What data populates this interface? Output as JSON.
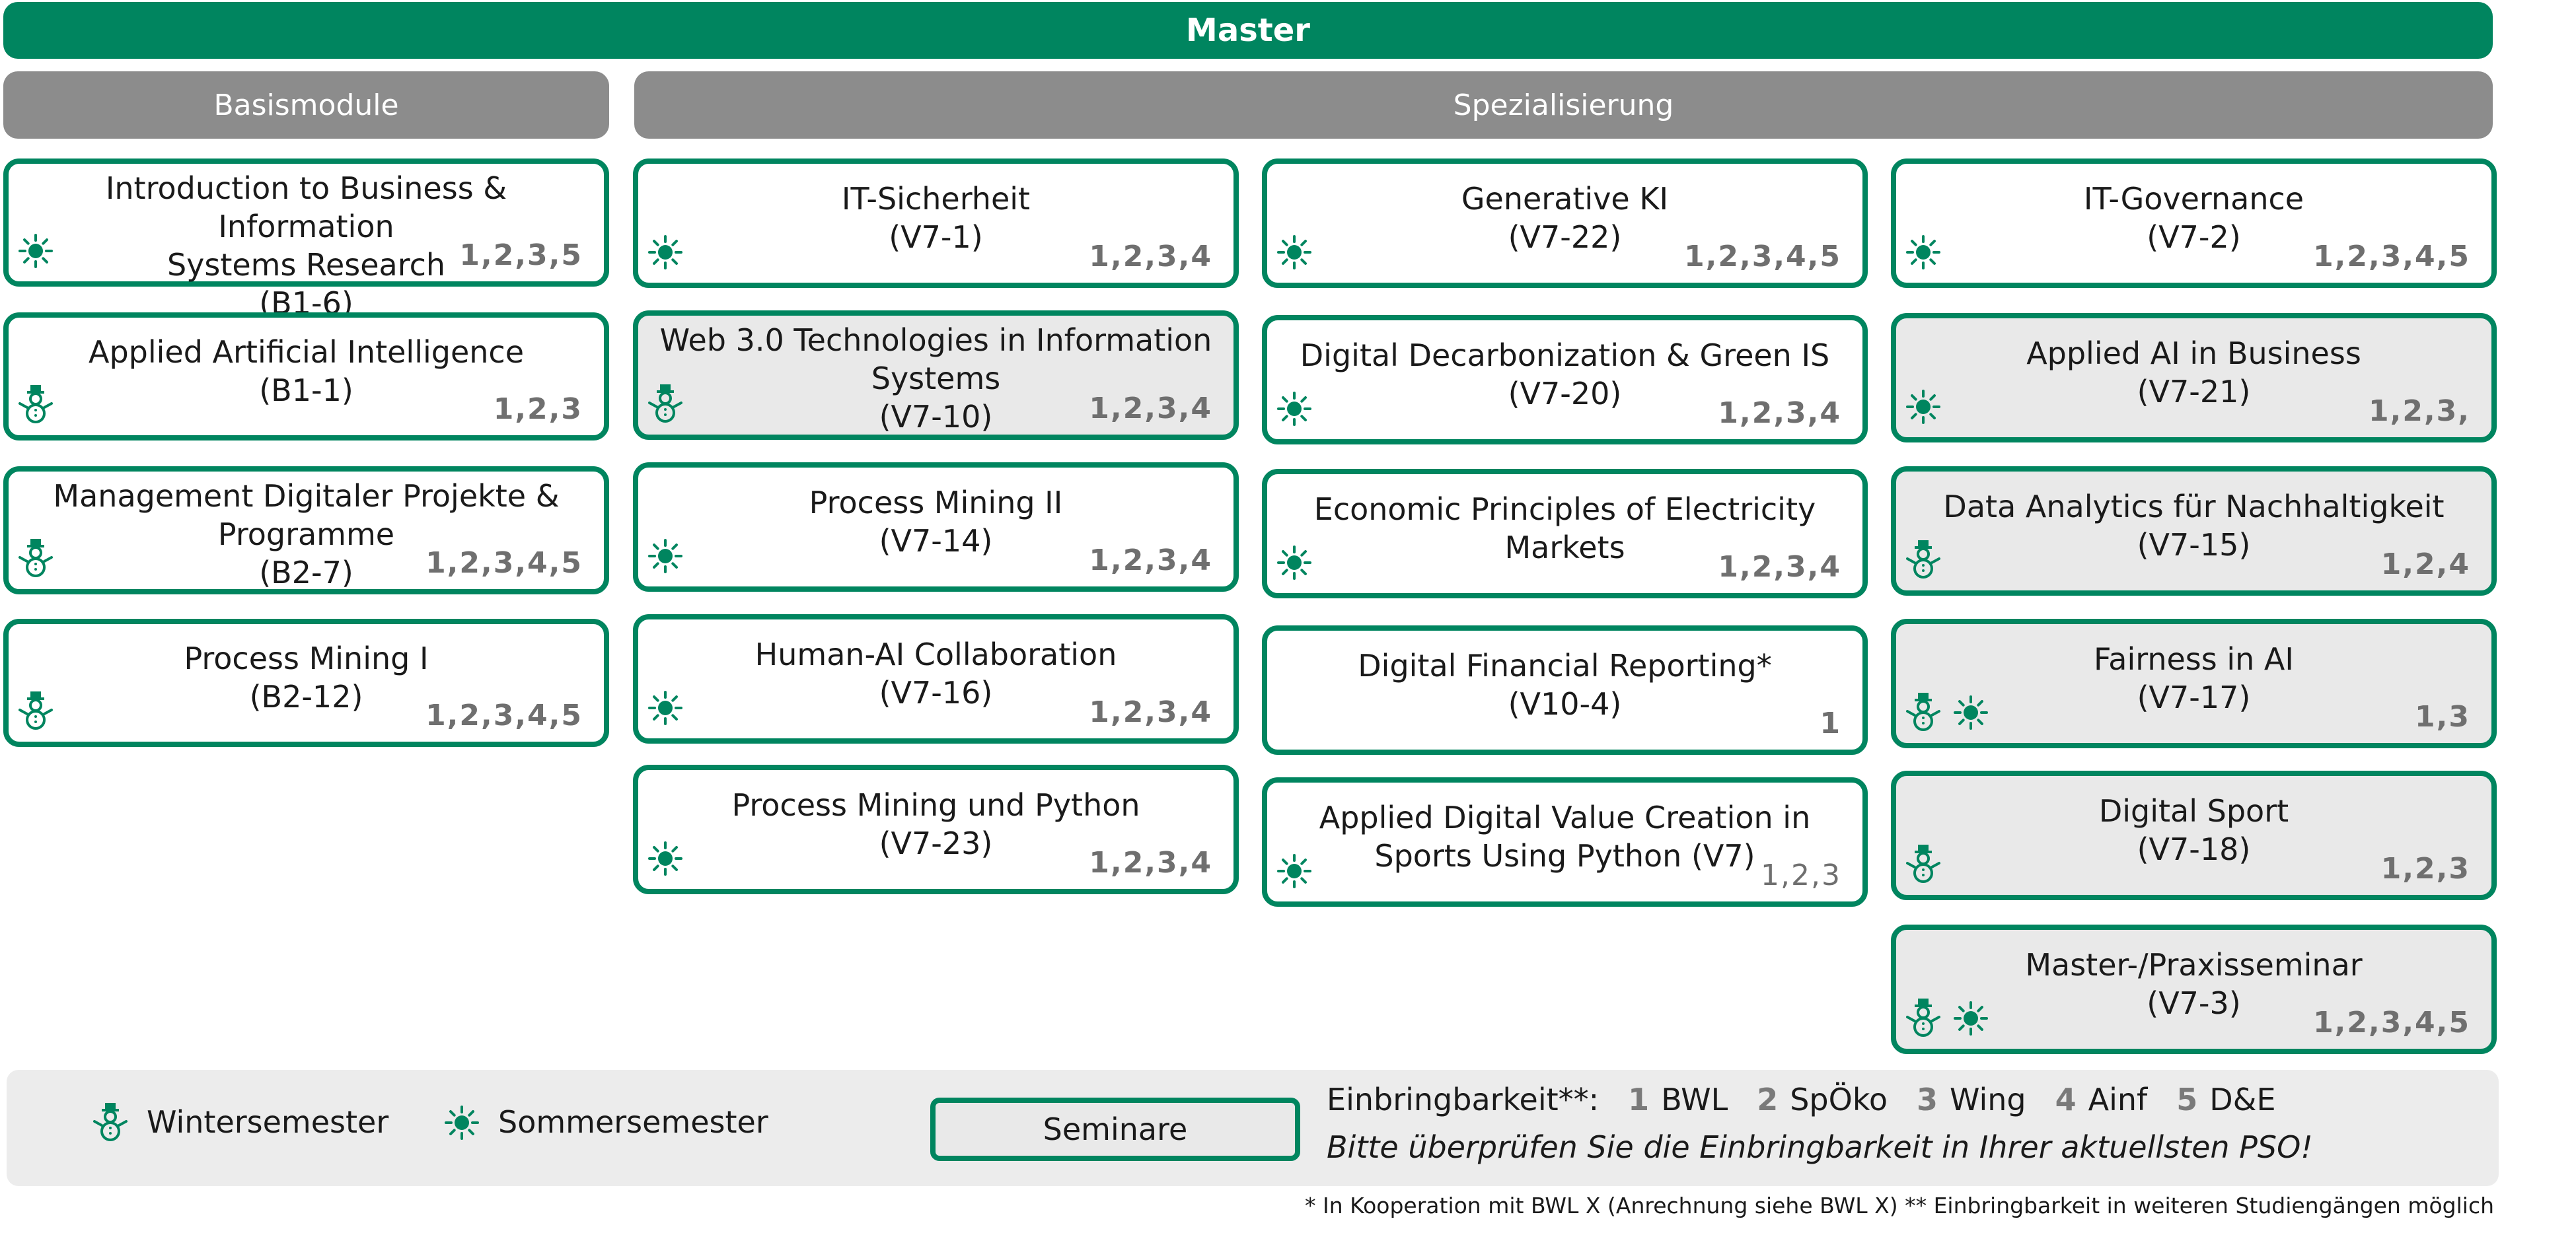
{
  "header": {
    "title": "Master"
  },
  "sections": {
    "basis": "Basismodule",
    "spez": "Spezialisierung"
  },
  "modules": [
    {
      "title": "Introduction to Business & Information\nSystems Research",
      "code": "(B1-6)",
      "codes": "1,2,3,5",
      "icons": [
        "sun-icon"
      ],
      "seminar": false
    },
    {
      "title": "Applied Artificial Intelligence",
      "code": "(B1-1)",
      "codes": "1,2,3",
      "icons": [
        "snowman-icon"
      ],
      "seminar": false
    },
    {
      "title": "Management Digitaler Projekte &\nProgramme",
      "code": "(B2-7)",
      "codes": "1,2,3,4,5",
      "icons": [
        "snowman-icon"
      ],
      "seminar": false
    },
    {
      "title": "Process Mining I",
      "code": "(B2-12)",
      "codes": "1,2,3,4,5",
      "icons": [
        "snowman-icon"
      ],
      "seminar": false
    },
    {
      "title": "IT-Sicherheit",
      "code": "(V7-1)",
      "codes": "1,2,3,4",
      "icons": [
        "sun-icon"
      ],
      "seminar": false
    },
    {
      "title": "Web 3.0 Technologies in Information\nSystems",
      "code": "(V7-10)",
      "codes": "1,2,3,4",
      "icons": [
        "snowman-icon"
      ],
      "seminar": true
    },
    {
      "title": "Process Mining II",
      "code": "(V7-14)",
      "codes": "1,2,3,4",
      "icons": [
        "sun-icon"
      ],
      "seminar": false
    },
    {
      "title": "Human-AI Collaboration",
      "code": "(V7-16)",
      "codes": "1,2,3,4",
      "icons": [
        "sun-icon"
      ],
      "seminar": false
    },
    {
      "title": "Process Mining und Python",
      "code": "(V7-23)",
      "codes": "1,2,3,4",
      "icons": [
        "sun-icon"
      ],
      "seminar": false
    },
    {
      "title": "Generative KI",
      "code": "(V7-22)",
      "codes": "1,2,3,4,5",
      "icons": [
        "sun-icon"
      ],
      "seminar": false
    },
    {
      "title": "Digital Decarbonization & Green IS",
      "code": "(V7-20)",
      "codes": "1,2,3,4",
      "icons": [
        "sun-icon"
      ],
      "seminar": false
    },
    {
      "title": "Economic Principles of Electricity\nMarkets",
      "code": "",
      "codes": "1,2,3,4",
      "icons": [
        "sun-icon"
      ],
      "seminar": false
    },
    {
      "title": "Digital Financial Reporting*",
      "code": "(V10-4)",
      "codes": "1",
      "icons": [],
      "seminar": false
    },
    {
      "title": "Applied Digital Value Creation in\nSports Using Python (V7)",
      "code": "",
      "codes": "1,2,3",
      "icons": [
        "sun-icon"
      ],
      "seminar": false,
      "light_codes": true
    },
    {
      "title": "IT-Governance",
      "code": "(V7-2)",
      "codes": "1,2,3,4,5",
      "icons": [
        "sun-icon"
      ],
      "seminar": false
    },
    {
      "title": "Applied AI in Business",
      "code": "(V7-21)",
      "codes": "1,2,3,",
      "icons": [
        "sun-icon"
      ],
      "seminar": true
    },
    {
      "title": "Data Analytics für Nachhaltigkeit",
      "code": "(V7-15)",
      "codes": "1,2,4",
      "icons": [
        "snowman-icon"
      ],
      "seminar": true
    },
    {
      "title": "Fairness in AI",
      "code": "(V7-17)",
      "codes": "1,3",
      "icons": [
        "snowman-icon",
        "sun-icon"
      ],
      "seminar": true
    },
    {
      "title": "Digital Sport",
      "code": "(V7-18)",
      "codes": "1,2,3",
      "icons": [
        "snowman-icon"
      ],
      "seminar": true
    },
    {
      "title": "Master-/Praxisseminar",
      "code": "(V7-3)",
      "codes": "1,2,3,4,5",
      "icons": [
        "snowman-icon",
        "sun-icon"
      ],
      "seminar": true
    }
  ],
  "legend": {
    "winter": "Wintersemester",
    "summer": "Sommersemester",
    "seminar": "Seminare",
    "einbring_label": "Einbringbarkeit**:",
    "einbring_items": [
      {
        "num": "1",
        "label": "BWL"
      },
      {
        "num": "2",
        "label": "SpÖko"
      },
      {
        "num": "3",
        "label": "Wing"
      },
      {
        "num": "4",
        "label": "Ainf"
      },
      {
        "num": "5",
        "label": "D&E"
      }
    ],
    "hint": "Bitte überprüfen Sie die Einbringbarkeit in Ihrer aktuellsten PSO!"
  },
  "footnote": "* In Kooperation mit BWL X (Anrechnung siehe BWL X)  ** Einbringbarkeit in weiteren Studiengängen möglich",
  "colors": {
    "accent": "#00855f",
    "seminar_bg": "#e9e9e9",
    "section_bar": "#8c8c8c"
  }
}
